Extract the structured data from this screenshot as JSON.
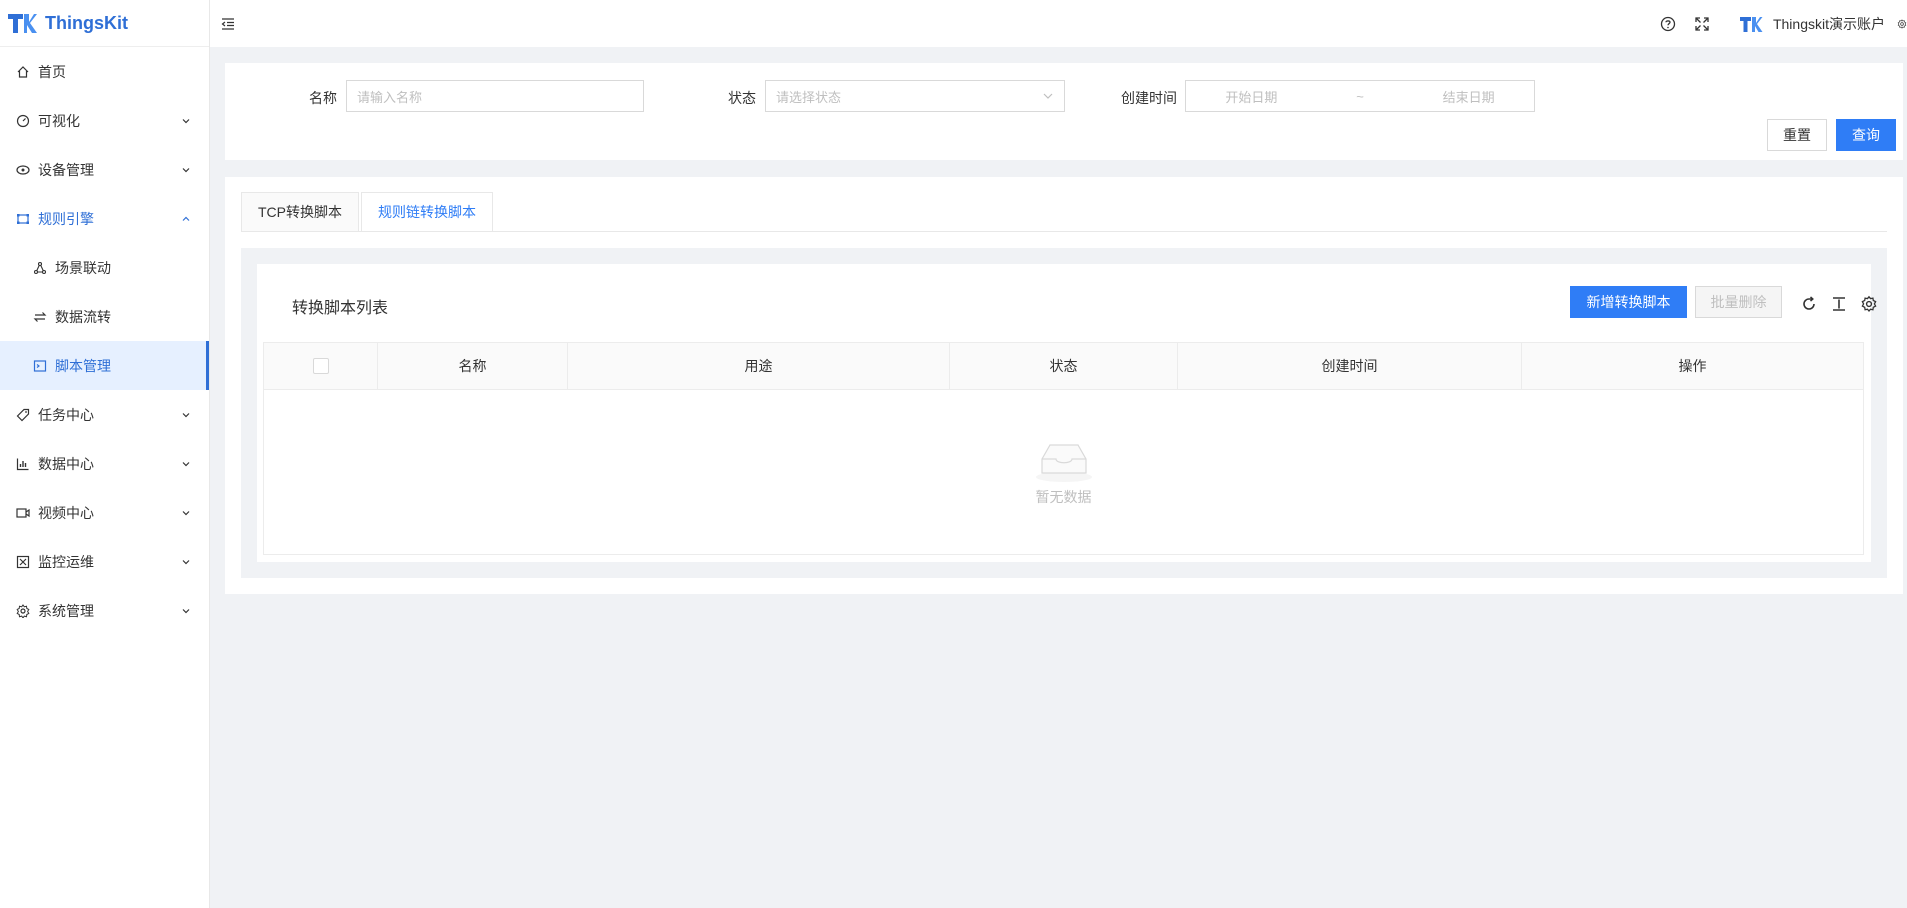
{
  "app": {
    "brand": "ThingsKit",
    "user_name": "Thingskit演示账户"
  },
  "sidebar": {
    "items": [
      {
        "label": "首页",
        "icon": "home-icon"
      },
      {
        "label": "可视化",
        "icon": "dashboard-icon"
      },
      {
        "label": "设备管理",
        "icon": "device-icon"
      },
      {
        "label": "规则引擎",
        "icon": "rule-engine-icon",
        "open": true,
        "children": [
          {
            "label": "场景联动",
            "icon": "linkage-icon"
          },
          {
            "label": "数据流转",
            "icon": "flow-icon"
          },
          {
            "label": "脚本管理",
            "icon": "script-icon",
            "active": true
          }
        ]
      },
      {
        "label": "任务中心",
        "icon": "task-icon"
      },
      {
        "label": "数据中心",
        "icon": "data-chart-icon"
      },
      {
        "label": "视频中心",
        "icon": "video-icon"
      },
      {
        "label": "监控运维",
        "icon": "monitor-icon"
      },
      {
        "label": "系统管理",
        "icon": "settings-icon"
      }
    ]
  },
  "search": {
    "name_label": "名称",
    "name_placeholder": "请输入名称",
    "status_label": "状态",
    "status_placeholder": "请选择状态",
    "time_label": "创建时间",
    "start_placeholder": "开始日期",
    "range_sep": "~",
    "end_placeholder": "结束日期",
    "reset_label": "重置",
    "query_label": "查询"
  },
  "tabs": [
    {
      "label": "TCP转换脚本",
      "active": false
    },
    {
      "label": "规则链转换脚本",
      "active": true
    }
  ],
  "list": {
    "title": "转换脚本列表",
    "add_label": "新增转换脚本",
    "batch_delete_label": "批量删除",
    "columns": [
      "名称",
      "用途",
      "状态",
      "创建时间",
      "操作"
    ],
    "empty_text": "暂无数据"
  },
  "colors": {
    "primary": "#2f7df6",
    "brand": "#2f6fd6"
  }
}
